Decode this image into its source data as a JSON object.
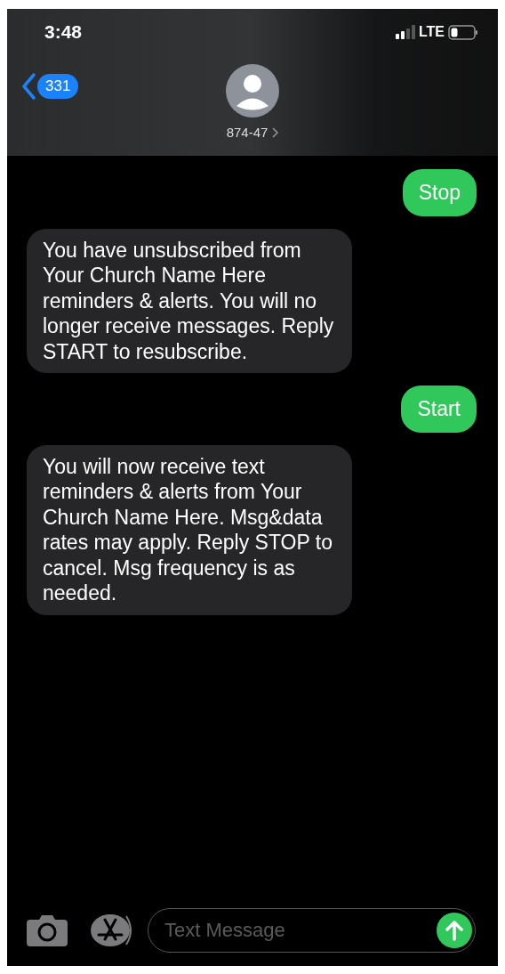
{
  "status_bar": {
    "time": "3:48",
    "network": "LTE"
  },
  "header": {
    "back_count": "331",
    "contact": "874-47"
  },
  "messages": [
    {
      "kind": "sent",
      "text": "Stop"
    },
    {
      "kind": "received",
      "text": "You have unsubscribed from Your Church Name Here reminders & alerts. You will no longer receive messages. Reply START to resubscribe."
    },
    {
      "kind": "sent",
      "text": "Start"
    },
    {
      "kind": "received",
      "text": "You will now receive text reminders & alerts from Your Church Name Here. Msg&data rates may apply. Reply STOP to cancel. Msg frequency is as needed."
    }
  ],
  "composer": {
    "placeholder": "Text Message"
  }
}
